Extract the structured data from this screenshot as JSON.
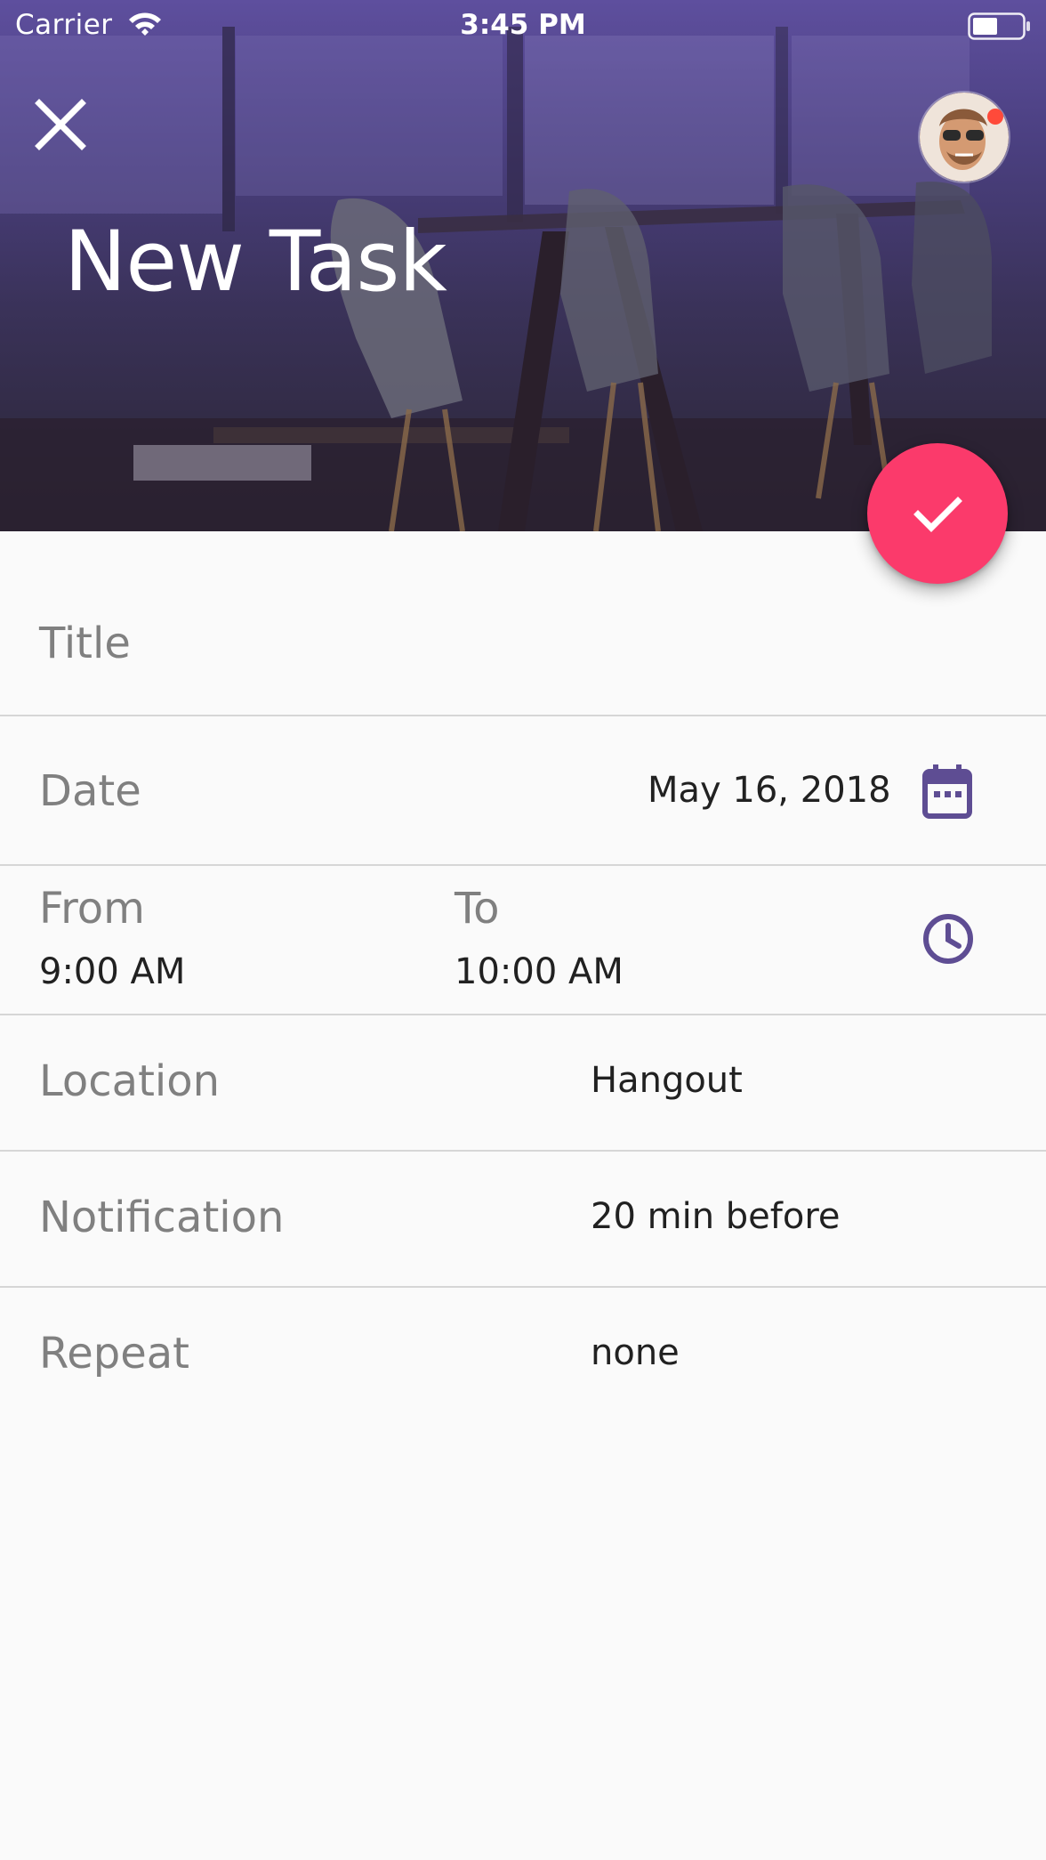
{
  "status_bar": {
    "carrier": "Carrier",
    "time": "3:45 PM",
    "battery_level": 0.5
  },
  "header": {
    "title": "New Task",
    "close_icon": "close-icon",
    "avatar_icon": "user-avatar",
    "notification_dot_color": "#ff4a3a"
  },
  "fab": {
    "icon": "check-icon",
    "color": "#fb3a6b"
  },
  "form": {
    "title_label": "Title",
    "date_label": "Date",
    "date_value": "May 16, 2018",
    "date_icon": "calendar-icon",
    "from_label": "From",
    "from_value": "9:00 AM",
    "to_label": "To",
    "to_value": "10:00 AM",
    "time_icon": "clock-icon",
    "location_label": "Location",
    "location_value": "Hangout",
    "notification_label": "Notification",
    "notification_value": "20 min before",
    "repeat_label": "Repeat",
    "repeat_value": "none"
  },
  "colors": {
    "accent": "#fb3a6b",
    "icon_purple": "#5e4d93",
    "header_tint": "#5e4f9e"
  }
}
